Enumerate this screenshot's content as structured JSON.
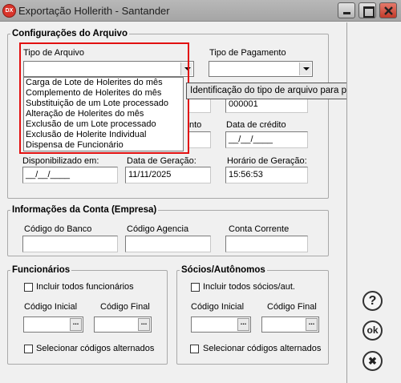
{
  "window": {
    "icon_text": "DX",
    "title": "Exportação Hollerith  - Santander"
  },
  "arquivo": {
    "legend": "Configurações do Arquivo",
    "tipo_arquivo_label": "Tipo de Arquivo",
    "tipo_arquivo_value": "",
    "tipo_pagamento_label": "Tipo de Pagamento",
    "tipo_pagamento_value": "",
    "options": [
      "Carga de Lote de Holerites do mês",
      "Complemento de Holerites do mês",
      "Substituição de um Lote processado",
      "Alteração de Holerites do mês",
      "Exclusão de um Lote processado",
      "Exclusão de Holerite Individual",
      "Dispensa de Funcionário"
    ],
    "tooltip": "Identificação do tipo de arquivo para processamento",
    "seq_value": "000001",
    "partial_label_nto": "nto",
    "data_credito_label": "Data de crédito",
    "data_credito_value": "__/__/____",
    "disponibilizado_label": "Disponibilizado em:",
    "disponibilizado_value": "__/__/____",
    "data_geracao_label": "Data de Geração:",
    "data_geracao_value": "11/11/2025",
    "horario_label": "Horário de Geração:",
    "horario_value": "15:56:53"
  },
  "conta": {
    "legend": "Informações da Conta (Empresa)",
    "banco_label": "Código do Banco",
    "agencia_label": "Código Agencia",
    "corrente_label": "Conta Corrente",
    "banco_value": "",
    "agencia_value": "",
    "corrente_value": ""
  },
  "funcionarios": {
    "legend": "Funcionários",
    "incluir_label": "Incluir todos funcionários",
    "inicial_label": "Código Inicial",
    "final_label": "Código Final",
    "alternados_label": "Selecionar códigos alternados",
    "picker_btn": "..."
  },
  "socios": {
    "legend": "Sócios/Autônomos",
    "incluir_label": "Incluir todos sócios/aut.",
    "inicial_label": "Código Inicial",
    "final_label": "Código Final",
    "alternados_label": "Selecionar códigos alternados",
    "picker_btn": "..."
  },
  "side": {
    "help": "?",
    "ok": "ok",
    "close": "✖"
  }
}
